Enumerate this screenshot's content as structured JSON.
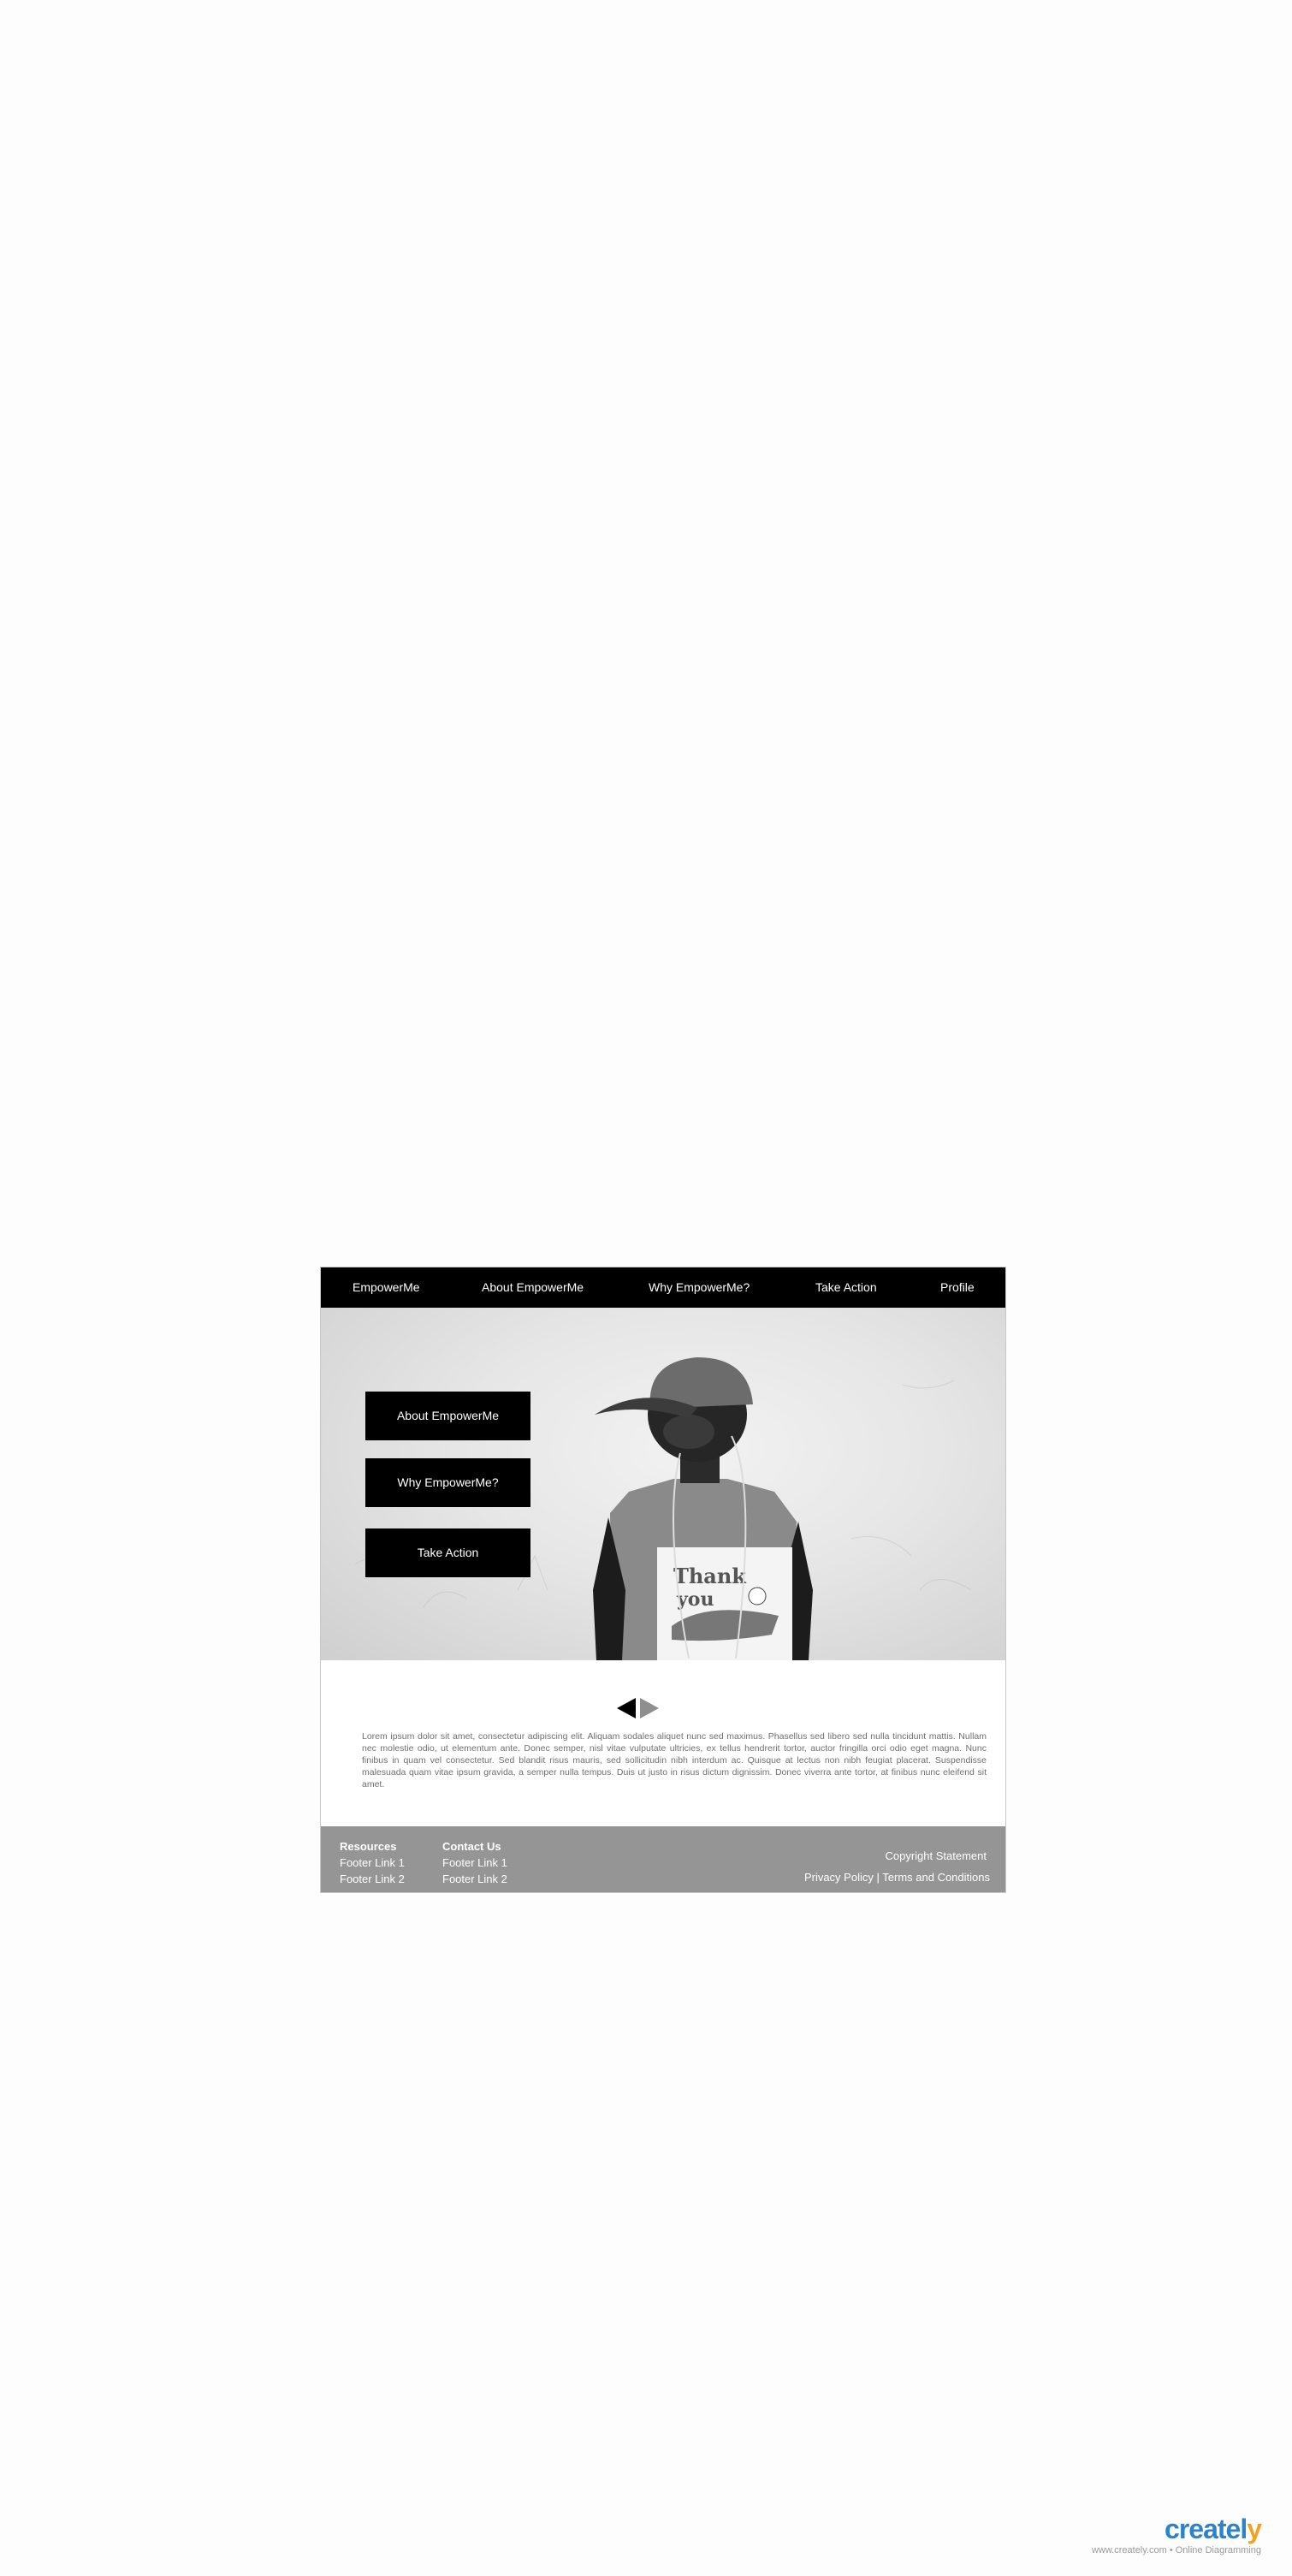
{
  "nav": {
    "brand": "EmpowerMe",
    "items": [
      "About EmpowerMe",
      "Why EmpowerMe?",
      "Take Action",
      "Profile"
    ]
  },
  "hero": {
    "buttons": [
      "About EmpowerMe",
      "Why EmpowerMe?",
      "Take Action"
    ],
    "photo_shirt_text": [
      "Thank",
      "you"
    ]
  },
  "carousel": {
    "prev_icon": "triangle-left-icon",
    "next_icon": "triangle-right-icon"
  },
  "body_text": "Lorem ipsum dolor sit amet, consectetur adipiscing elit. Aliquam sodales aliquet nunc sed maximus. Phasellus sed libero sed nulla tincidunt mattis. Nullam nec molestie odio, ut elementum ante. Donec semper, nisl vitae vulputate ultricies, ex tellus hendrerit tortor, auctor fringilla orci odio eget magna. Nunc finibus in quam vel consectetur. Sed blandit risus mauris, sed sollicitudin nibh interdum ac. Quisque at lectus non nibh feugiat placerat. Suspendisse malesuada quam vitae ipsum gravida, a semper nulla tempus. Duis ut justo in risus dictum dignissim. Donec viverra ante tortor, at finibus nunc eleifend sit amet.",
  "footer": {
    "resources": {
      "heading": "Resources",
      "links": [
        "Footer Link 1",
        "Footer Link 2"
      ]
    },
    "contact": {
      "heading": "Contact Us",
      "links": [
        "Footer Link 1",
        "Footer Link 2"
      ]
    },
    "copyright": "Copyright Statement",
    "privacy": "Privacy Policy",
    "separator": "|",
    "terms": "Terms and Conditions"
  },
  "watermark": {
    "logo_main": "createl",
    "logo_accent": "y",
    "tagline": "www.creately.com • Online Diagramming"
  },
  "colors": {
    "nav_bg": "#000000",
    "footer_bg": "#959595",
    "logo_blue": "#2c84c8",
    "logo_orange": "#f3a41e"
  }
}
